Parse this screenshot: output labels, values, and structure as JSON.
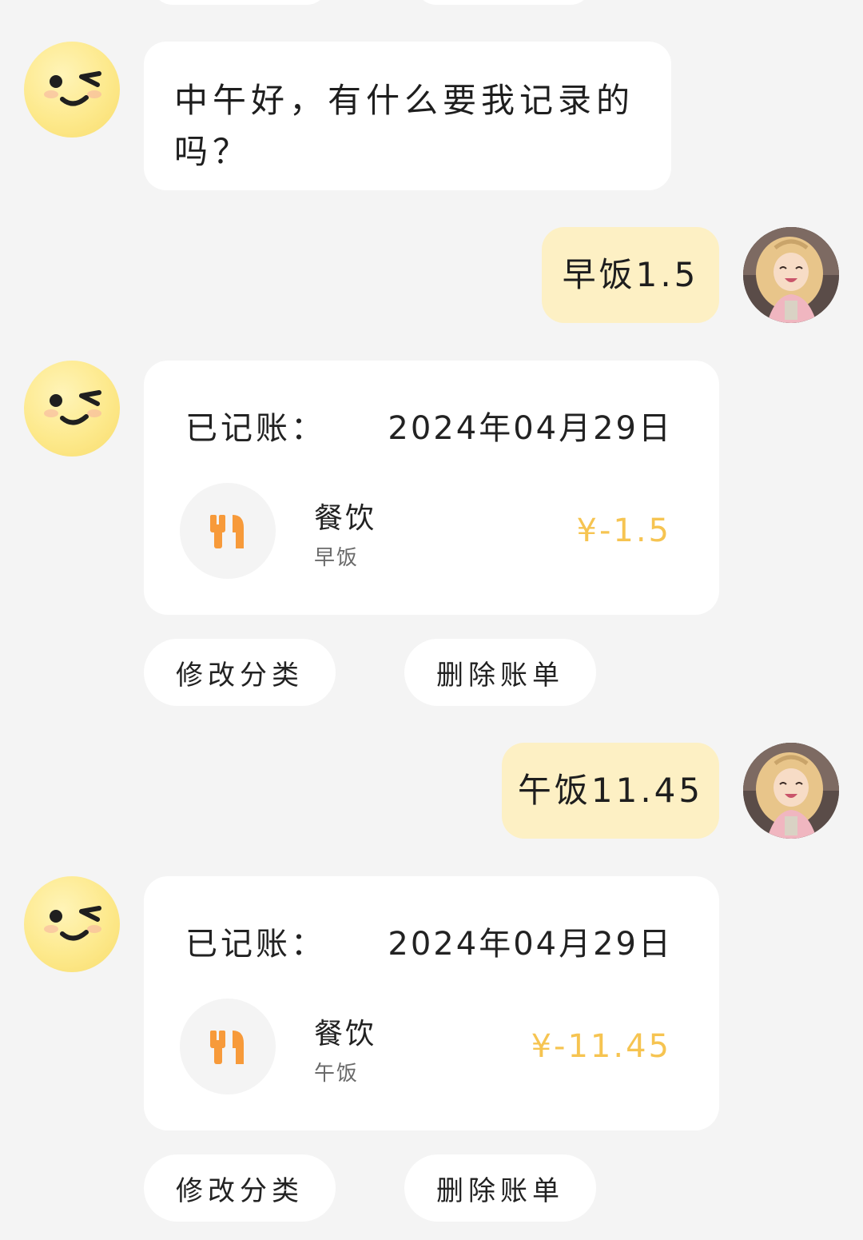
{
  "messages": {
    "greeting": {
      "text": "中午好，有什么要我记录的吗？"
    },
    "user_1": {
      "text": "早饭1.5"
    },
    "record_1": {
      "label": "已记账：",
      "date": "2024年04月29日",
      "category": "餐饮",
      "note": "早饭",
      "amount": "¥-1.5",
      "icon": "utensils-icon"
    },
    "actions_1": {
      "edit": "修改分类",
      "delete": "删除账单"
    },
    "user_2": {
      "text": "午饭11.45"
    },
    "record_2": {
      "label": "已记账：",
      "date": "2024年04月29日",
      "category": "餐饮",
      "note": "午饭",
      "amount": "¥-11.45",
      "icon": "utensils-icon"
    },
    "actions_2": {
      "edit": "修改分类",
      "delete": "删除账单"
    }
  },
  "colors": {
    "background": "#f4f4f4",
    "user_bubble": "#fdf0c4",
    "amount": "#f6c451",
    "icon_orange": "#f79a3a",
    "bot_avatar": "#fde98c"
  },
  "icons": {
    "bot_avatar": "wink-face-icon",
    "user_avatar": "user-avatar-image",
    "category": "utensils-icon"
  }
}
